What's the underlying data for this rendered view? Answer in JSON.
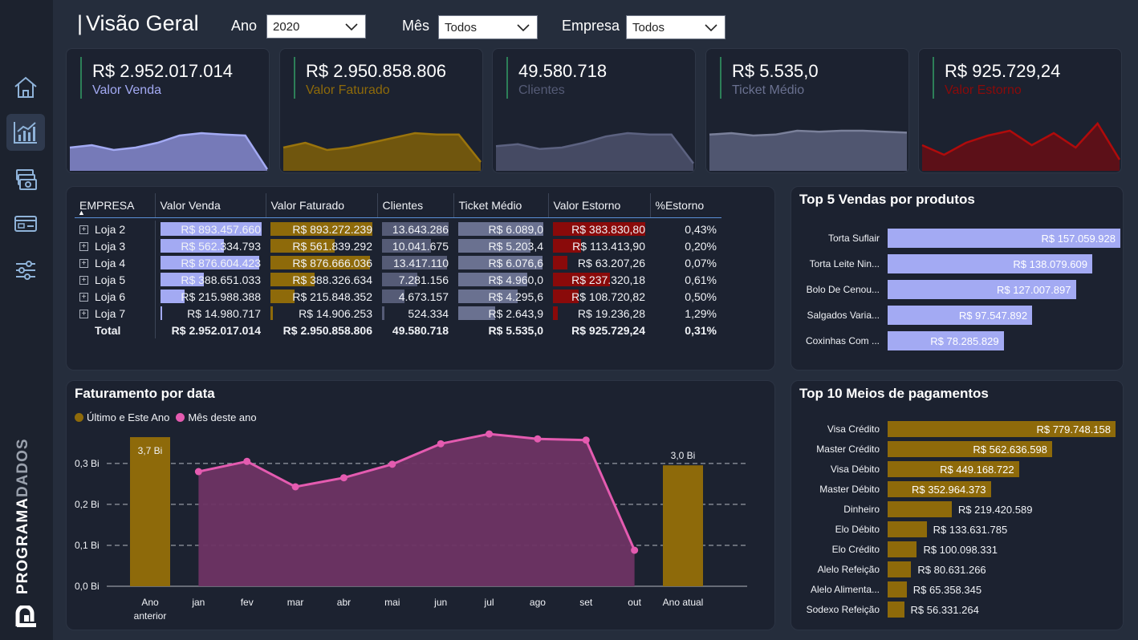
{
  "header": {
    "title": "Visão Geral",
    "filters": [
      {
        "label": "Ano",
        "value": "2020"
      },
      {
        "label": "Mês",
        "value": "Todos"
      },
      {
        "label": "Empresa",
        "value": "Todos"
      }
    ]
  },
  "sidebar": {
    "items": [
      {
        "icon": "home-icon"
      },
      {
        "icon": "chart-icon",
        "active": true
      },
      {
        "icon": "money-icon"
      },
      {
        "icon": "card-icon"
      },
      {
        "icon": "sliders-icon"
      }
    ],
    "brand_part1": "PROGRAMA",
    "brand_part2": "DADOS"
  },
  "colors": {
    "venda": "#a3aaf3",
    "faturado": "#8e6a0a",
    "clientes": "#555b76",
    "ticket": "#6a7190",
    "estorno": "#8a0a0a",
    "pink": "#e45bb0"
  },
  "kpis": [
    {
      "value": "R$ 2.952.017.014",
      "label": "Valor Venda",
      "label_color": "#a3aaf3",
      "fill": "#767ab8",
      "stroke": "#a3aaf3",
      "spark": [
        0.45,
        0.5,
        0.4,
        0.45,
        0.55,
        0.7,
        0.75,
        0.72,
        0.7,
        0.0
      ]
    },
    {
      "value": "R$ 2.950.858.806",
      "label": "Valor Faturado",
      "label_color": "#8e6a0a",
      "fill": "#70560e",
      "stroke": "#9a740c",
      "spark": [
        0.45,
        0.55,
        0.4,
        0.45,
        0.55,
        0.65,
        0.75,
        0.72,
        0.72,
        0.15
      ]
    },
    {
      "value": "49.580.718",
      "label": "Clientes",
      "label_color": "#555b76",
      "fill": "#454a63",
      "stroke": "#5c6280",
      "spark": [
        0.48,
        0.52,
        0.42,
        0.45,
        0.55,
        0.68,
        0.75,
        0.72,
        0.72,
        0.12
      ]
    },
    {
      "value": "R$ 5.535,0",
      "label": "Ticket Médio",
      "label_color": "#6a7190",
      "fill": "#505670",
      "stroke": "#7a809a",
      "spark": [
        0.72,
        0.75,
        0.7,
        0.72,
        0.8,
        0.78,
        0.8,
        0.8,
        0.78,
        0.76
      ]
    },
    {
      "value": "R$ 925.729,24",
      "label": "Valor Estorno",
      "label_color": "#8a0a0a",
      "fill": "#5c1018",
      "stroke": "#b00b0b",
      "spark": [
        0.5,
        0.3,
        0.55,
        0.7,
        0.8,
        0.5,
        0.75,
        0.45,
        0.95,
        0.2
      ]
    }
  ],
  "matrix": {
    "columns": [
      "EMPRESA",
      "Valor Venda",
      "Valor Faturado",
      "Clientes",
      "Ticket Médio",
      "Valor Estorno",
      "%Estorno"
    ],
    "rows": [
      {
        "name": "Loja 2",
        "venda": "R$ 893.457.660",
        "venda_frac": 1.0,
        "faturado": "R$ 893.272.239",
        "faturado_frac": 1.0,
        "clientes": "13.643.286",
        "clientes_frac": 1.0,
        "ticket": "R$ 6.089,0",
        "ticket_frac": 1.0,
        "estorno": "R$ 383.830,80",
        "estorno_frac": 1.0,
        "pct": "0,43%"
      },
      {
        "name": "Loja 3",
        "venda": "R$ 562.334.793",
        "venda_frac": 0.63,
        "faturado": "R$ 561.839.292",
        "faturado_frac": 0.63,
        "clientes": "10.041.675",
        "clientes_frac": 0.74,
        "ticket": "R$ 5.203,4",
        "ticket_frac": 0.85,
        "estorno": "R$ 113.413,90",
        "estorno_frac": 0.3,
        "pct": "0,20%"
      },
      {
        "name": "Loja 4",
        "venda": "R$ 876.604.423",
        "venda_frac": 0.98,
        "faturado": "R$ 876.666.036",
        "faturado_frac": 0.98,
        "clientes": "13.417.110",
        "clientes_frac": 0.98,
        "ticket": "R$ 6.076,6",
        "ticket_frac": 0.99,
        "estorno": "R$ 63.207,26",
        "estorno_frac": 0.16,
        "pct": "0,07%"
      },
      {
        "name": "Loja 5",
        "venda": "R$ 388.651.033",
        "venda_frac": 0.43,
        "faturado": "R$ 388.326.634",
        "faturado_frac": 0.43,
        "clientes": "7.281.156",
        "clientes_frac": 0.53,
        "ticket": "R$ 4.960,0",
        "ticket_frac": 0.81,
        "estorno": "R$ 237.320,18",
        "estorno_frac": 0.62,
        "pct": "0,61%"
      },
      {
        "name": "Loja 6",
        "venda": "R$ 215.988.388",
        "venda_frac": 0.24,
        "faturado": "R$ 215.848.352",
        "faturado_frac": 0.24,
        "clientes": "4.673.157",
        "clientes_frac": 0.34,
        "ticket": "R$ 4.295,6",
        "ticket_frac": 0.7,
        "estorno": "R$ 108.720,82",
        "estorno_frac": 0.28,
        "pct": "0,50%"
      },
      {
        "name": "Loja 7",
        "venda": "R$ 14.980.717",
        "venda_frac": 0.02,
        "faturado": "R$ 14.906.253",
        "faturado_frac": 0.02,
        "clientes": "524.334",
        "clientes_frac": 0.04,
        "ticket": "R$ 2.643,9",
        "ticket_frac": 0.43,
        "estorno": "R$ 19.236,28",
        "estorno_frac": 0.05,
        "pct": "1,29%"
      }
    ],
    "total": {
      "name": "Total",
      "venda": "R$ 2.952.017.014",
      "faturado": "R$ 2.950.858.806",
      "clientes": "49.580.718",
      "ticket": "R$ 5.535,0",
      "estorno": "R$ 925.729,24",
      "pct": "0,31%"
    }
  },
  "top5": {
    "title": "Top 5 Vendas por produtos",
    "items": [
      {
        "name": "Torta Suflair",
        "value": 157059928,
        "label": "R$ 157.059.928"
      },
      {
        "name": "Torta Leite Nin...",
        "value": 138079609,
        "label": "R$ 138.079.609"
      },
      {
        "name": "Bolo De Cenou...",
        "value": 127007897,
        "label": "R$ 127.007.897"
      },
      {
        "name": "Salgados Varia...",
        "value": 97547892,
        "label": "R$ 97.547.892"
      },
      {
        "name": "Coxinhas Com ...",
        "value": 78285829,
        "label": "R$ 78.285.829"
      }
    ]
  },
  "top10": {
    "title": "Top 10 Meios de pagamentos",
    "items": [
      {
        "name": "Visa Crédito",
        "value": 779748158,
        "label": "R$ 779.748.158"
      },
      {
        "name": "Master Crédito",
        "value": 562636598,
        "label": "R$ 562.636.598"
      },
      {
        "name": "Visa Débito",
        "value": 449168722,
        "label": "R$ 449.168.722"
      },
      {
        "name": "Master Débito",
        "value": 352964373,
        "label": "R$ 352.964.373"
      },
      {
        "name": "Dinheiro",
        "value": 219420589,
        "label": "R$ 219.420.589"
      },
      {
        "name": "Elo Débito",
        "value": 133631785,
        "label": "R$ 133.631.785"
      },
      {
        "name": "Elo Crédito",
        "value": 100098331,
        "label": "R$ 100.098.331"
      },
      {
        "name": "Alelo Refeição",
        "value": 80631266,
        "label": "R$ 80.631.266"
      },
      {
        "name": "Alelo Alimenta...",
        "value": 65358345,
        "label": "R$ 65.358.345"
      },
      {
        "name": "Sodexo Refeição",
        "value": 56331264,
        "label": "R$ 56.331.264"
      }
    ]
  },
  "chart_data": {
    "type": "bar",
    "title": "Faturamento por data",
    "legend": [
      "Último e Este Ano",
      "Mês deste ano"
    ],
    "categories": [
      "Ano anterior",
      "jan",
      "fev",
      "mar",
      "abr",
      "mai",
      "jun",
      "jul",
      "ago",
      "set",
      "out",
      "Ano atual"
    ],
    "bars": [
      {
        "category": "Ano anterior",
        "value": 3.7,
        "label": "3,7 Bi"
      },
      {
        "category": "Ano atual",
        "value": 3.0,
        "label": "3,0 Bi"
      }
    ],
    "monthly": {
      "x": [
        "jan",
        "fev",
        "mar",
        "abr",
        "mai",
        "jun",
        "jul",
        "ago",
        "set",
        "out"
      ],
      "y": [
        0.28,
        0.305,
        0.243,
        0.265,
        0.298,
        0.348,
        0.372,
        0.36,
        0.357,
        0.088
      ]
    },
    "yticks": [
      "0,0 Bi",
      "0,1 Bi",
      "0,2 Bi",
      "0,3 Bi"
    ],
    "ylim": [
      0,
      0.38
    ]
  }
}
